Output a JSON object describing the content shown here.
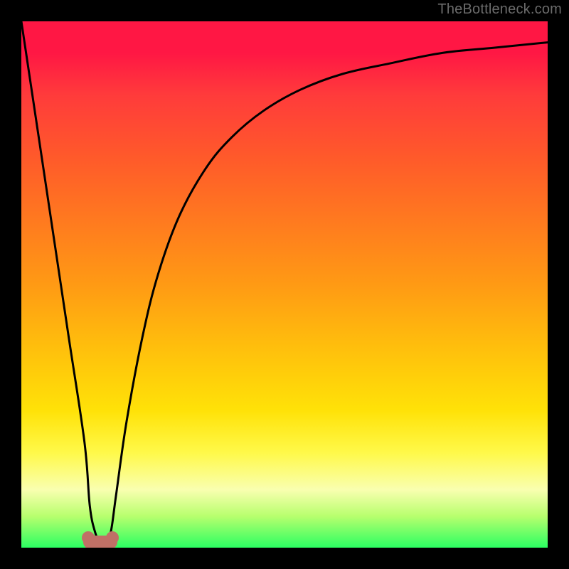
{
  "attribution": "TheBottleneck.com",
  "chart_data": {
    "type": "line",
    "title": "",
    "xlabel": "",
    "ylabel": "",
    "xlim": [
      0,
      100
    ],
    "ylim": [
      0,
      100
    ],
    "grid": false,
    "series": [
      {
        "name": "bottleneck-curve",
        "x": [
          0,
          3,
          6,
          9,
          12,
          13,
          14,
          15,
          16,
          17,
          18,
          20,
          23,
          26,
          30,
          35,
          40,
          46,
          53,
          61,
          70,
          80,
          90,
          100
        ],
        "y": [
          100,
          80,
          60,
          40,
          20,
          8,
          3,
          1,
          1,
          3,
          10,
          24,
          40,
          52,
          63,
          72,
          78,
          83,
          87,
          90,
          92,
          94,
          95,
          96
        ]
      }
    ],
    "marker": {
      "x": 15,
      "y": 1
    }
  },
  "colors": {
    "curve": "#000000",
    "marker": "#c07066",
    "background_top": "#ff1744",
    "background_bottom": "#2bff62"
  }
}
